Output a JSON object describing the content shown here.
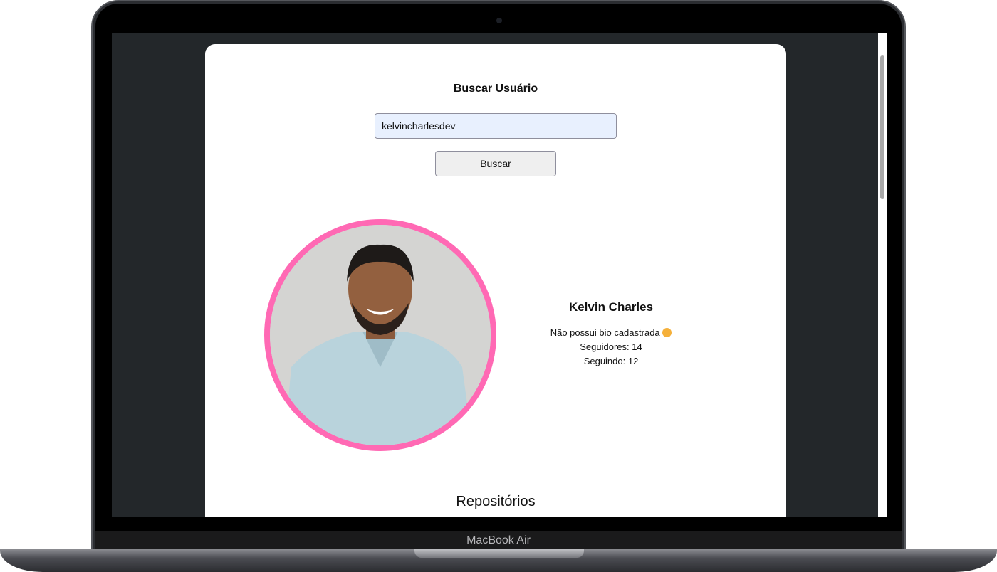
{
  "device": {
    "label": "MacBook Air"
  },
  "search": {
    "title": "Buscar Usuário",
    "input_value": "kelvincharlesdev",
    "button_label": "Buscar"
  },
  "profile": {
    "name": "Kelvin Charles",
    "bio": "Não possui bio cadastrada",
    "followers": "Seguidores: 14",
    "following": "Seguindo: 12",
    "avatar_border_color": "#ff69b4"
  },
  "repositories": {
    "title": "Repositórios"
  }
}
